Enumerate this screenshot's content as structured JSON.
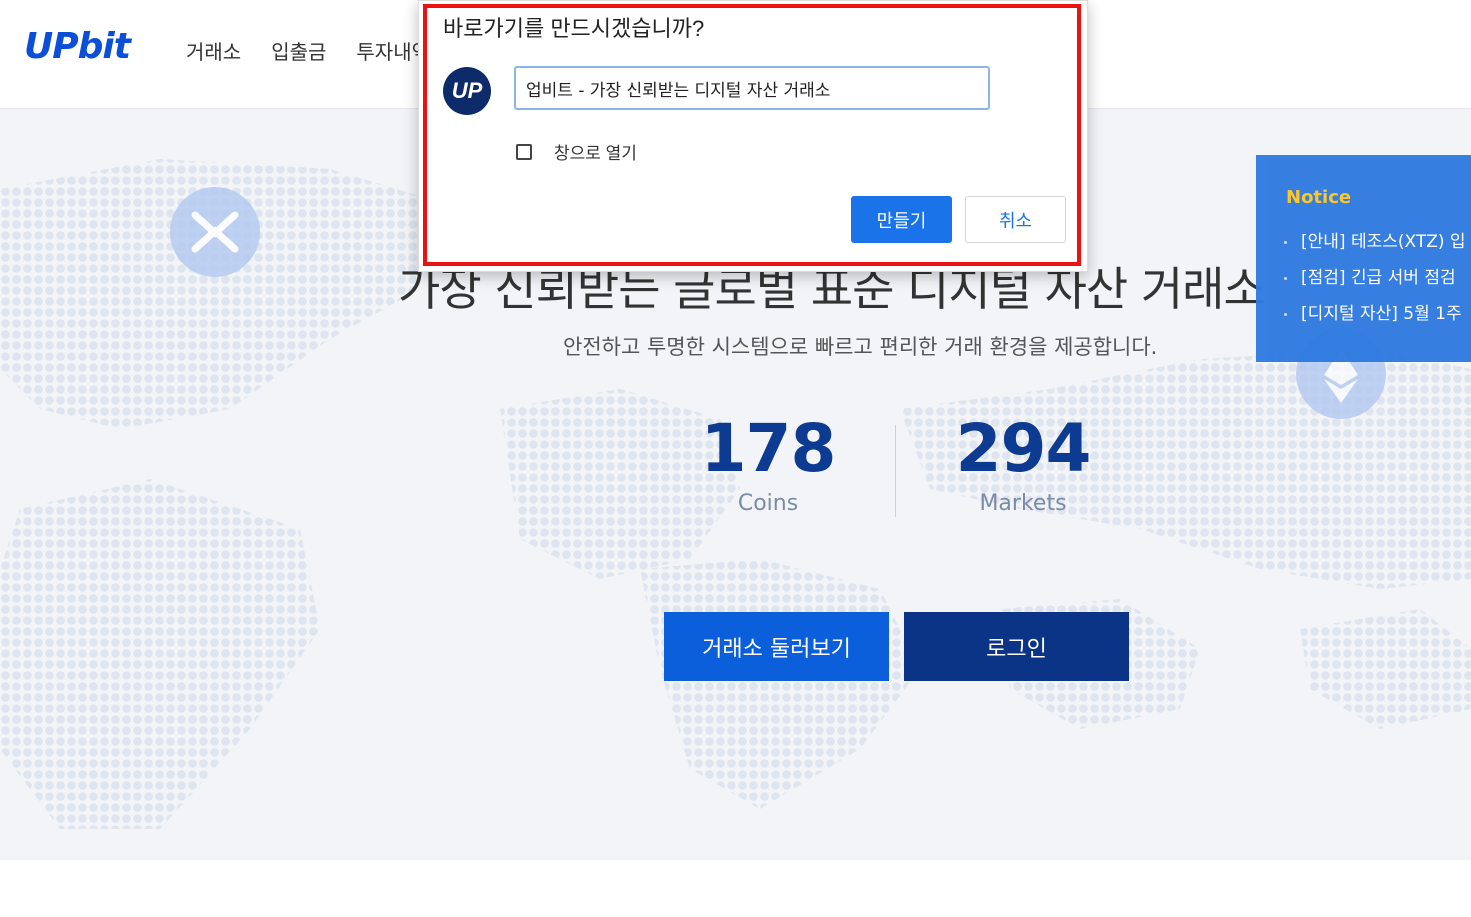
{
  "header": {
    "logo": "UPbit",
    "nav": [
      "거래소",
      "입출금",
      "투자내역"
    ]
  },
  "hero": {
    "title": "가장 신뢰받는 글로벌 표준 디지털 자산 거래소",
    "subtitle": "안전하고 투명한 시스템으로 빠르고 편리한 거래 환경을 제공합니다.",
    "stats": [
      {
        "value": "178",
        "label": "Coins"
      },
      {
        "value": "294",
        "label": "Markets"
      }
    ],
    "explore_button": "거래소 둘러보기",
    "login_button": "로그인"
  },
  "notice": {
    "title": "Notice",
    "items": [
      "[안내] 테조스(XTZ) 입",
      "[점검] 긴급 서버 점검",
      "[디지털 자산] 5월 1주"
    ]
  },
  "dialog": {
    "title": "바로가기를 만드시겠습니까?",
    "icon_text": "UP",
    "input_value": "업비트 - 가장 신뢰받는 디지털 자산 거래소",
    "checkbox_label": "창으로 열기",
    "create_button": "만들기",
    "cancel_button": "취소",
    "highlight_color": "#ee1111"
  },
  "colors": {
    "brand": "#0b4ed8",
    "primary_button": "#0b5fdb",
    "dark_button": "#0b3487",
    "notice_bg": "#2f7ae0",
    "notice_title": "#ffc61e"
  }
}
